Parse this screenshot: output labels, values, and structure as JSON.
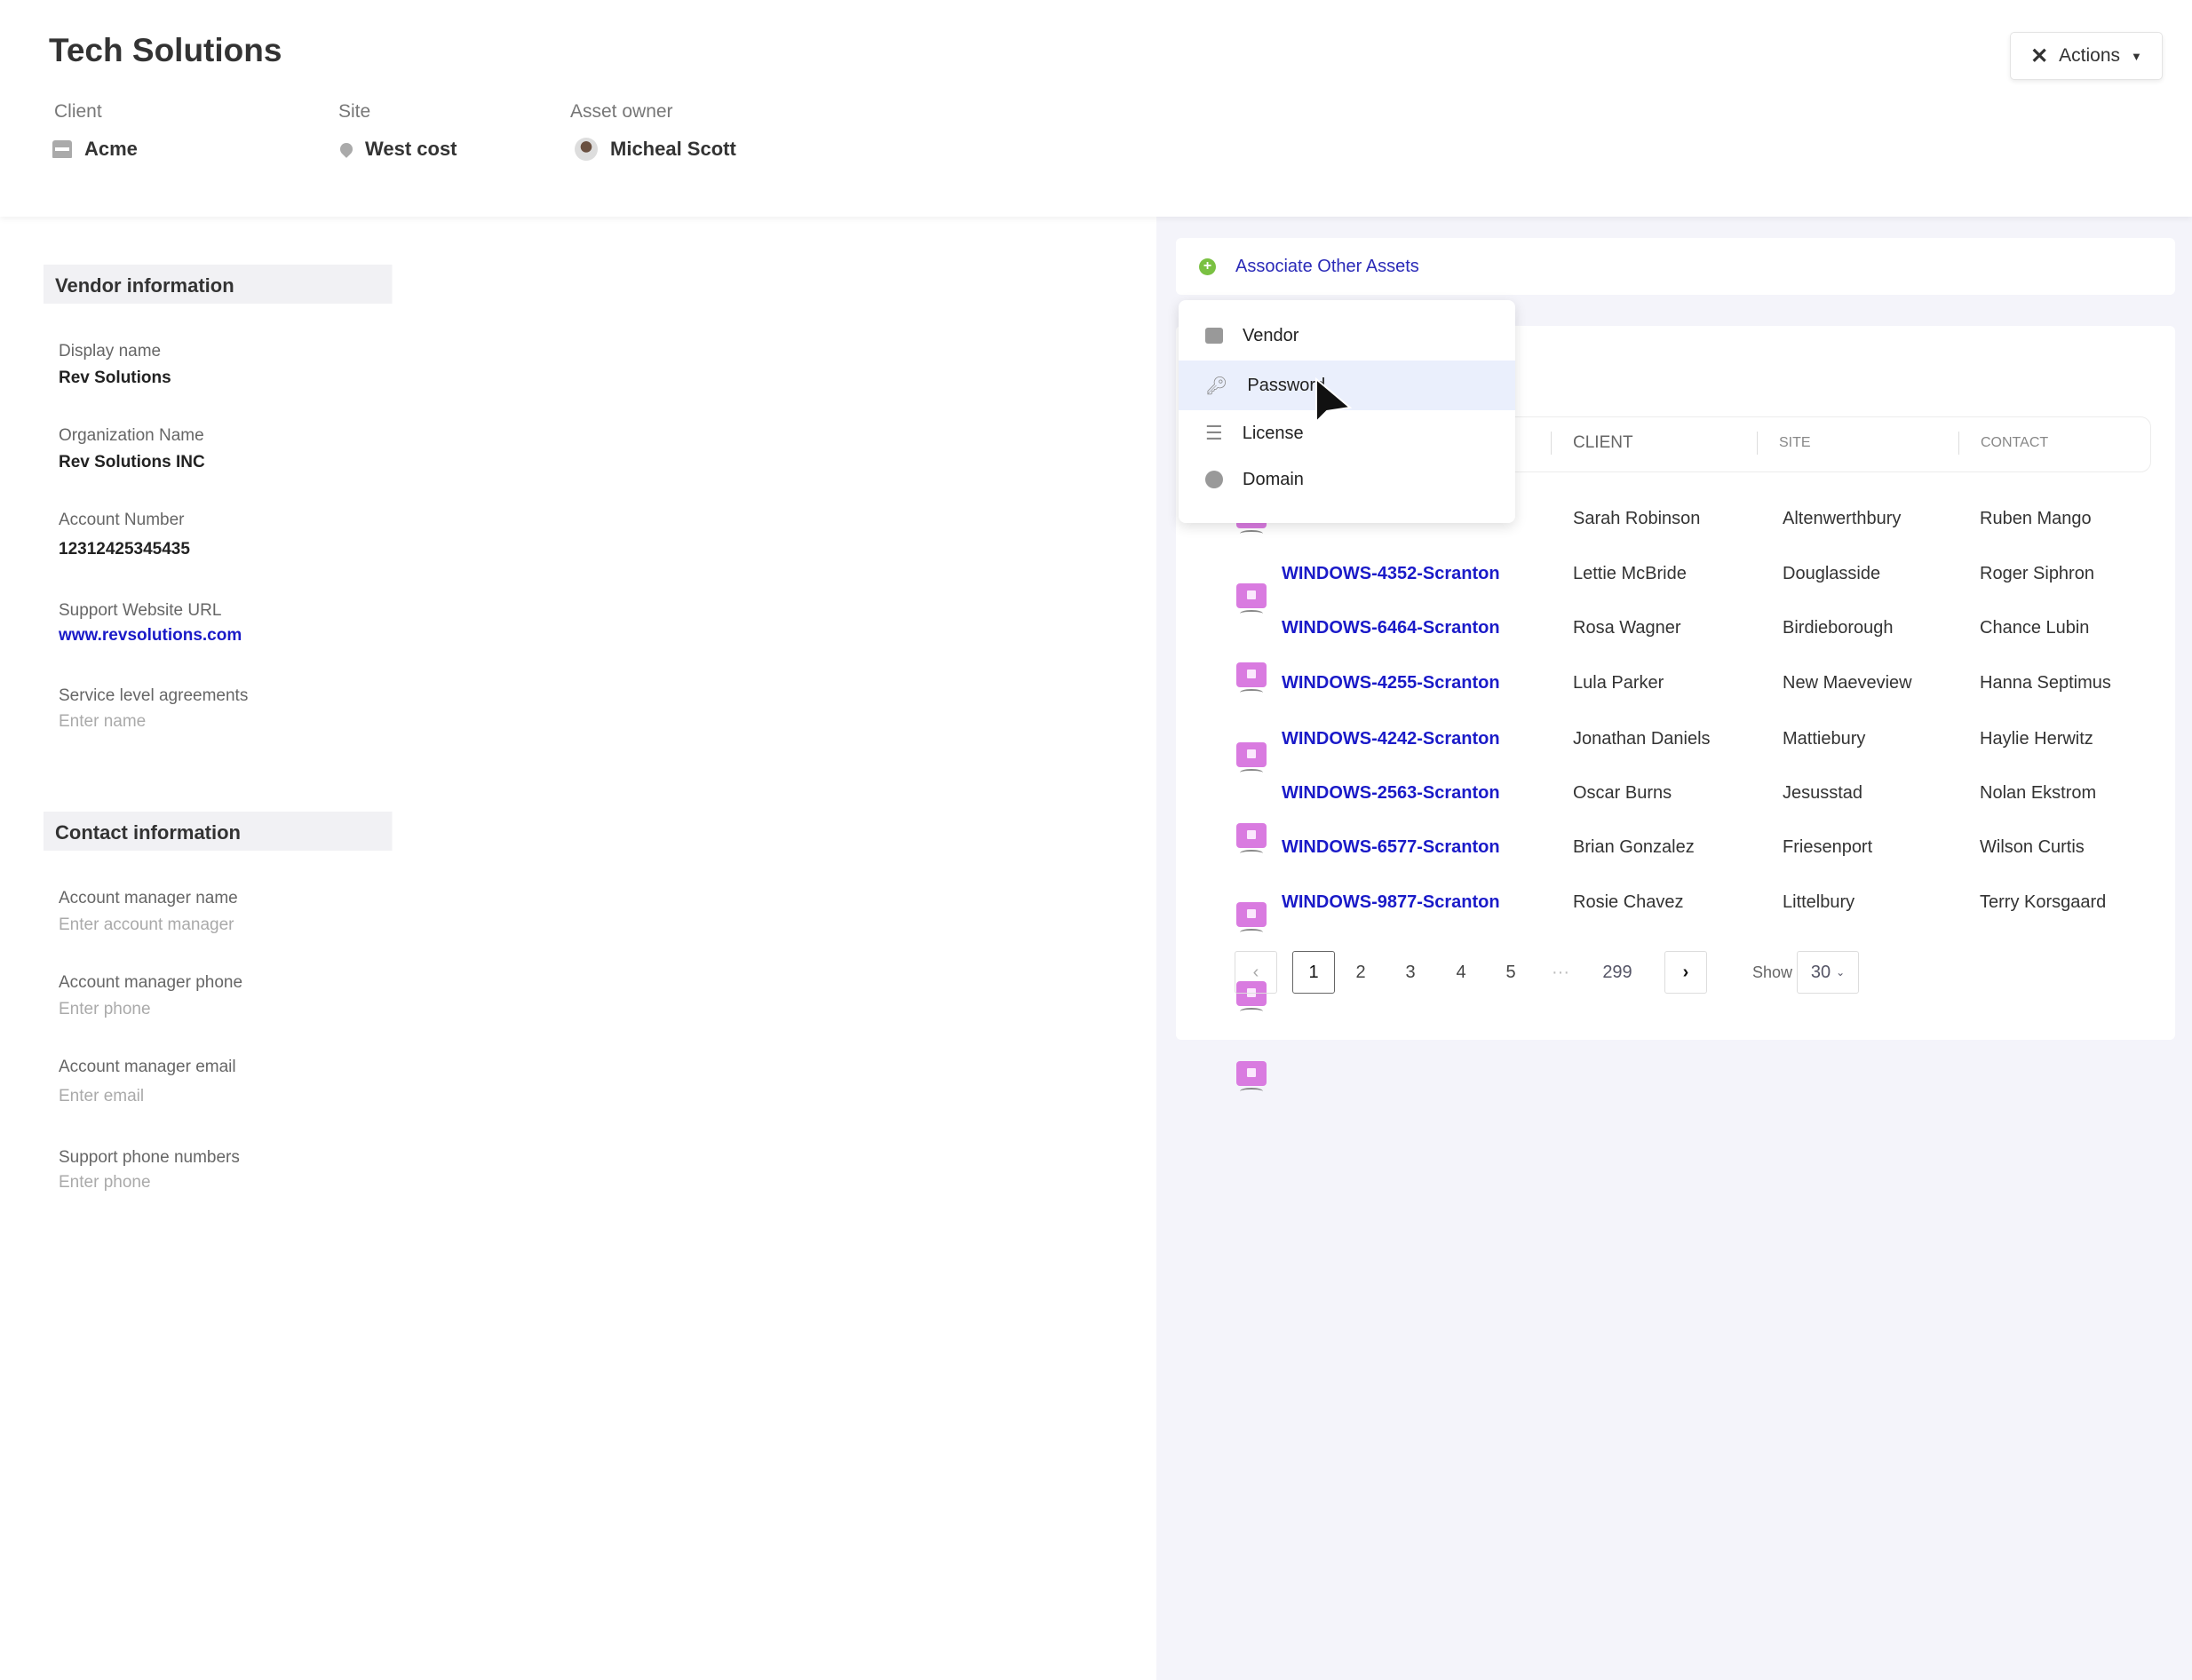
{
  "header": {
    "title": "Tech Solutions",
    "actions_label": "Actions",
    "meta": [
      {
        "label": "Client",
        "value": "Acme",
        "icon": "store-icon"
      },
      {
        "label": "Site",
        "value": "West cost",
        "icon": "location-pin-icon"
      },
      {
        "label": "Asset owner",
        "value": "Micheal Scott",
        "icon": "avatar"
      }
    ]
  },
  "vendor_info": {
    "heading": "Vendor information",
    "fields": [
      {
        "label": "Display name",
        "value": "Rev Solutions"
      },
      {
        "label": "Organization Name",
        "value": "Rev Solutions INC"
      },
      {
        "label": "Account Number",
        "value": "12312425345435"
      },
      {
        "label": "Support Website URL",
        "value": "www.revsolutions.com"
      },
      {
        "label": "Service level agreements",
        "placeholder": "Enter name"
      }
    ]
  },
  "contact_info": {
    "heading": "Contact information",
    "fields": [
      {
        "label": "Account manager name",
        "placeholder": "Enter account manager"
      },
      {
        "label": "Account manager phone",
        "placeholder": "Enter phone"
      },
      {
        "label": "Account manager email",
        "placeholder": "Enter email"
      },
      {
        "label": "Support phone numbers",
        "placeholder": "Enter phone"
      }
    ]
  },
  "associate": {
    "label": "Associate Other Assets"
  },
  "dropdown": {
    "items": [
      {
        "label": "Vendor",
        "icon": "store-icon"
      },
      {
        "label": "Password",
        "icon": "key-icon",
        "active": true
      },
      {
        "label": "License",
        "icon": "list-icon"
      },
      {
        "label": "Domain",
        "icon": "globe-icon"
      }
    ]
  },
  "table": {
    "columns": [
      "CLIENT",
      "SITE",
      "CONTACT"
    ],
    "rows": [
      {
        "name": "",
        "client": "Sarah Robinson",
        "site": "Altenwerthbury",
        "contact": "Ruben Mango"
      },
      {
        "name": "WINDOWS-4352-Scranton",
        "client": "Lettie McBride",
        "site": "Douglasside",
        "contact": "Roger Siphron"
      },
      {
        "name": "WINDOWS-6464-Scranton",
        "client": "Rosa Wagner",
        "site": "Birdieborough",
        "contact": "Chance Lubin"
      },
      {
        "name": "WINDOWS-4255-Scranton",
        "client": "Lula Parker",
        "site": "New Maeveview",
        "contact": "Hanna Septimus"
      },
      {
        "name": "WINDOWS-4242-Scranton",
        "client": "Jonathan Daniels",
        "site": "Mattiebury",
        "contact": "Haylie Herwitz"
      },
      {
        "name": "WINDOWS-2563-Scranton",
        "client": "Oscar Burns",
        "site": "Jesusstad",
        "contact": "Nolan Ekstrom"
      },
      {
        "name": "WINDOWS-6577-Scranton",
        "client": "Brian Gonzalez",
        "site": "Friesenport",
        "contact": "Wilson Curtis"
      },
      {
        "name": "WINDOWS-9877-Scranton",
        "client": "Rosie Chavez",
        "site": "Littelbury",
        "contact": "Terry Korsgaard"
      }
    ]
  },
  "pagination": {
    "pages": [
      "1",
      "2",
      "3",
      "4",
      "5"
    ],
    "ellipsis": "···",
    "last": "299",
    "current": "1",
    "show_label": "Show",
    "page_size": "30"
  },
  "colors": {
    "link": "#1a1ac8",
    "accent_green": "#7ac142",
    "device_icon": "#d97be0",
    "panel_bg": "#f4f4fa"
  }
}
